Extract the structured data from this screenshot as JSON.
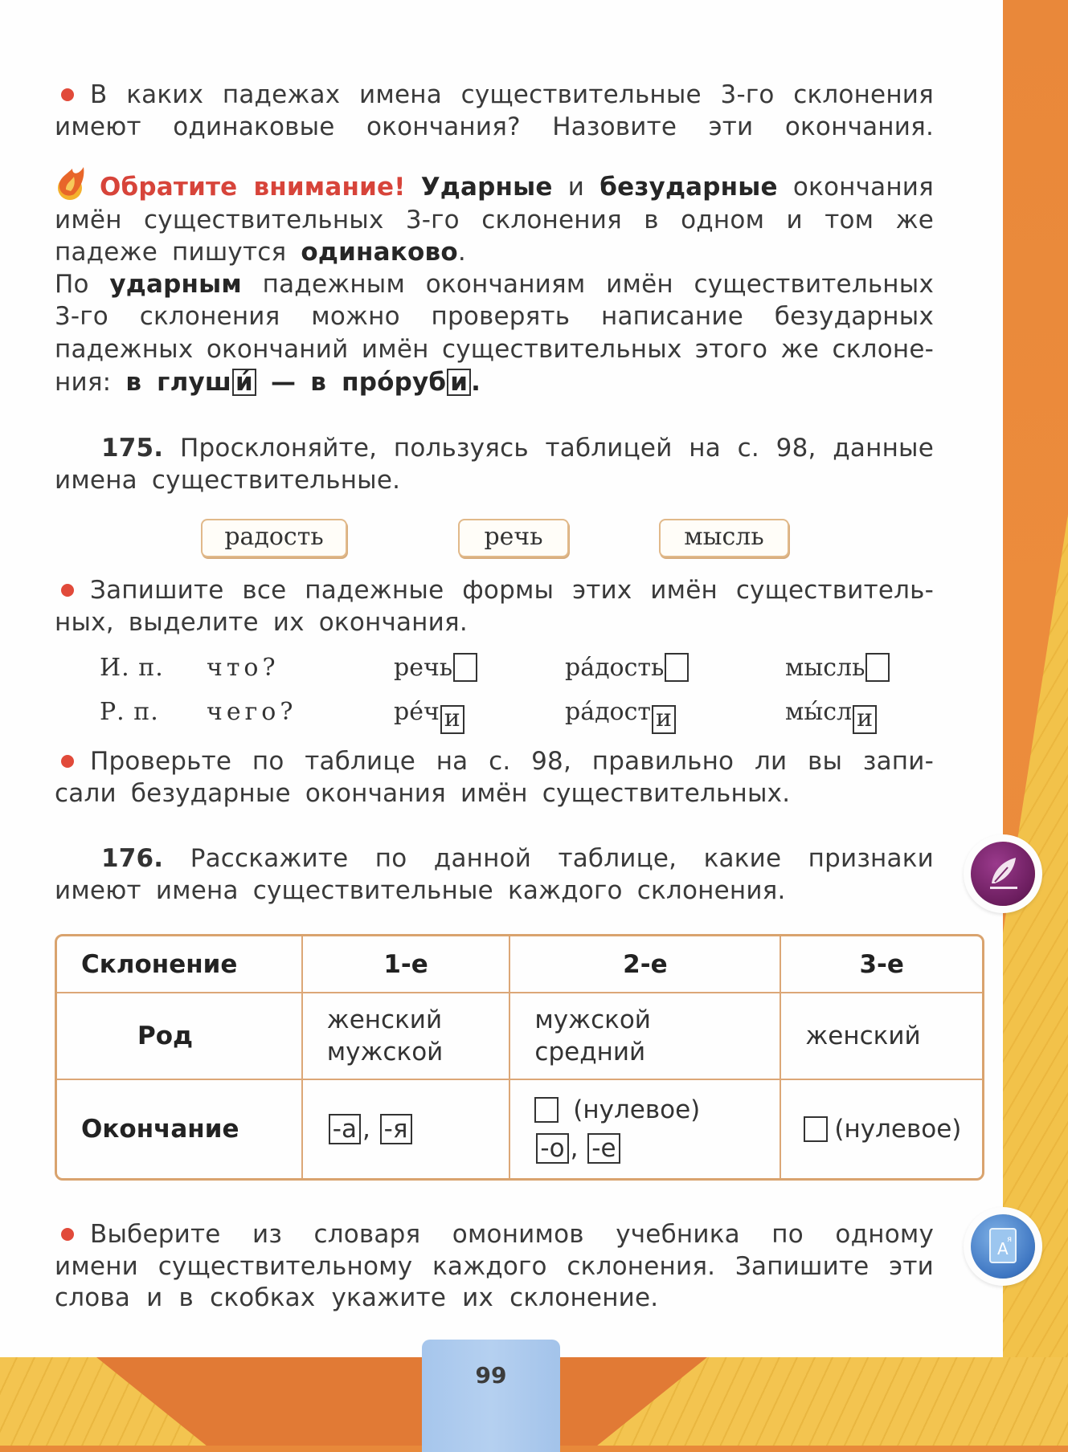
{
  "intro_question": {
    "line1": "В каких падежах имена существительные 3-го склонения",
    "line2": "имеют одинаковые окончания? Назовите эти окончания."
  },
  "attention": {
    "label": "Обратите внимание!",
    "l1_b1": "Ударные",
    "l1_t1": "и",
    "l1_b2": "безударные",
    "l1_t2": "окончания",
    "l2": "имён существительных 3-го склонения в одном и том же",
    "l3_t": "падеже пишутся",
    "l3_b": "одинаково",
    "l3_end": ".",
    "l4_t1": "По",
    "l4_b": "ударным",
    "l4_t2": "падежным окончаниям имён существительных",
    "l5": "3-го склонения можно проверять написание безударных",
    "l6": "падежных окончаний имён существительных этого же склоне-",
    "l7_t": "ния:",
    "l7_ex1_pre": "в глуш",
    "l7_ex1_end": "и́",
    "l7_dash": "—",
    "l7_ex2_pre": "в про́руб",
    "l7_ex2_end": "и",
    "l7_dot": "."
  },
  "ex175": {
    "number": "175.",
    "line1": "Просклоняйте, пользуясь таблицей на с. 98, данные",
    "line2": "имена существительные.",
    "words": [
      "радость",
      "речь",
      "мысль"
    ],
    "task_line1": "Запишите все падежные формы этих имён существитель-",
    "task_line2": "ных, выделите их окончания.",
    "cases": [
      {
        "label": "И. п.",
        "question": "что?",
        "forms": [
          {
            "stem": "речь",
            "ending": ""
          },
          {
            "stem": "ра́дость",
            "ending": ""
          },
          {
            "stem": "мысль",
            "ending": ""
          }
        ]
      },
      {
        "label": "Р. п.",
        "question": "чего?",
        "forms": [
          {
            "stem": "ре́ч",
            "ending": "и"
          },
          {
            "stem": "ра́дост",
            "ending": "и"
          },
          {
            "stem": "мы́сл",
            "ending": "и"
          }
        ]
      }
    ],
    "check_line1": "Проверьте по таблице на с. 98, правильно ли вы запи-",
    "check_line2": "сали безударные окончания имён существительных."
  },
  "ex176": {
    "number": "176.",
    "line1": "Расскажите по данной таблице, какие признаки",
    "line2": "имеют имена существительные каждого склонения.",
    "table": {
      "headers": [
        "Склонение",
        "1-е",
        "2-е",
        "3-е"
      ],
      "gender_label": "Род",
      "gender": [
        [
          "женский",
          "мужской"
        ],
        [
          "мужской",
          "средний"
        ],
        [
          "женский"
        ]
      ],
      "ending_label": "Окончание",
      "endings_1": [
        "-а",
        "-я"
      ],
      "endings_2_zero": "(нулевое)",
      "endings_2": [
        "-о",
        "-е"
      ],
      "endings_3_zero": "(нулевое)",
      "comma": ","
    }
  },
  "final_task": {
    "line1": "Выберите из словаря омонимов учебника по одному",
    "line2": "имени существительному каждого склонения. Запишите эти",
    "line3": "слова и в скобках укажите их склонение."
  },
  "side_icons": {
    "writing": "feather-icon",
    "dictionary": "dictionary-icon"
  },
  "page_number": "99",
  "colors": {
    "bullet": "#e14a3a",
    "attention_red": "#d7443a",
    "table_border": "#d9a36e",
    "bg_orange": "#e8893a",
    "tab_blue": "#b5d0f0"
  }
}
